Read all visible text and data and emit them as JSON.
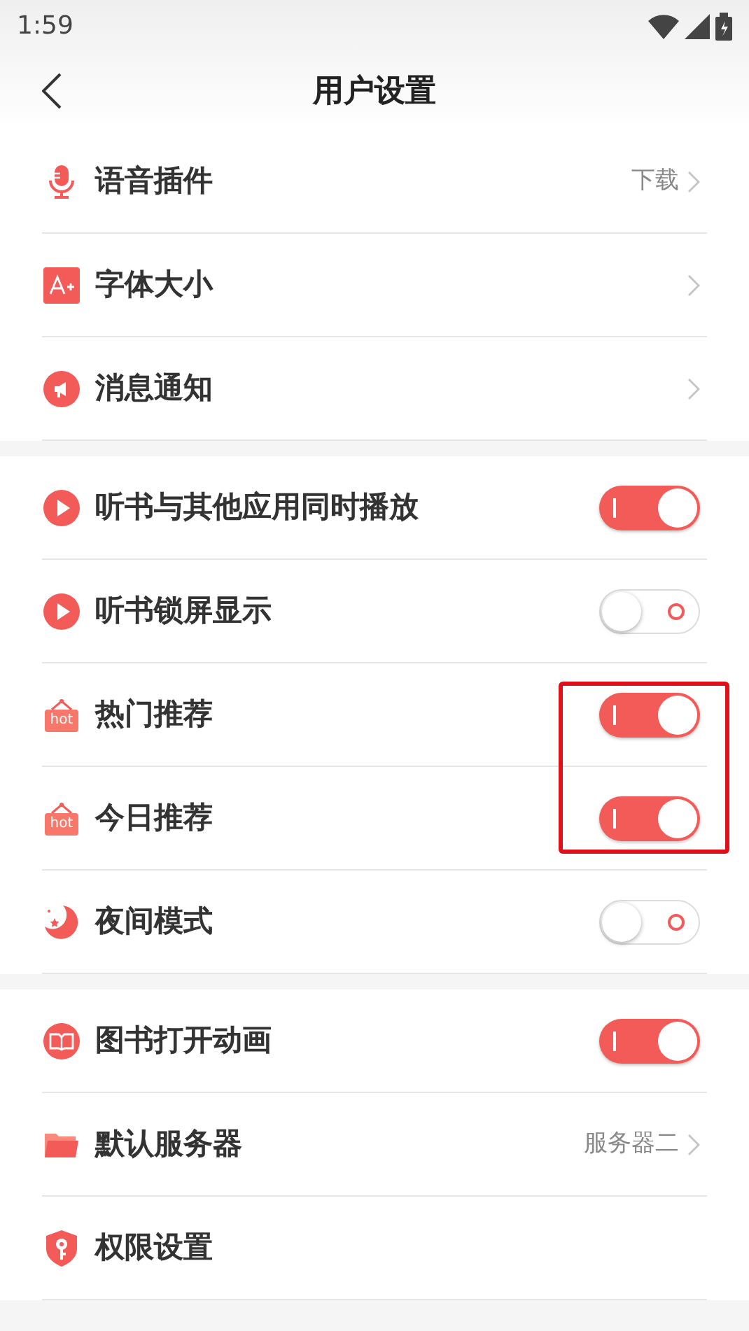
{
  "status_bar": {
    "time": "1:59"
  },
  "header": {
    "title": "用户设置"
  },
  "sections": [
    {
      "items": [
        {
          "kind": "link",
          "label": "语音插件",
          "value": "下载"
        },
        {
          "kind": "link",
          "label": "字体大小"
        },
        {
          "kind": "link",
          "label": "消息通知"
        }
      ]
    },
    {
      "items": [
        {
          "kind": "toggle",
          "label": "听书与其他应用同时播放",
          "on": true,
          "highlighted": false
        },
        {
          "kind": "toggle",
          "label": "听书锁屏显示",
          "on": false,
          "highlighted": false
        },
        {
          "kind": "toggle",
          "icon_text": "hot",
          "label": "热门推荐",
          "on": true,
          "highlighted": true
        },
        {
          "kind": "toggle",
          "icon_text": "hot",
          "label": "今日推荐",
          "on": true,
          "highlighted": true
        },
        {
          "kind": "toggle",
          "label": "夜间模式",
          "on": false,
          "highlighted": false
        }
      ]
    },
    {
      "items": [
        {
          "kind": "toggle",
          "label": "图书打开动画",
          "on": true,
          "highlighted": false
        },
        {
          "kind": "link",
          "label": "默认服务器",
          "value": "服务器二"
        },
        {
          "kind": "plain",
          "label": "权限设置"
        }
      ]
    }
  ]
}
